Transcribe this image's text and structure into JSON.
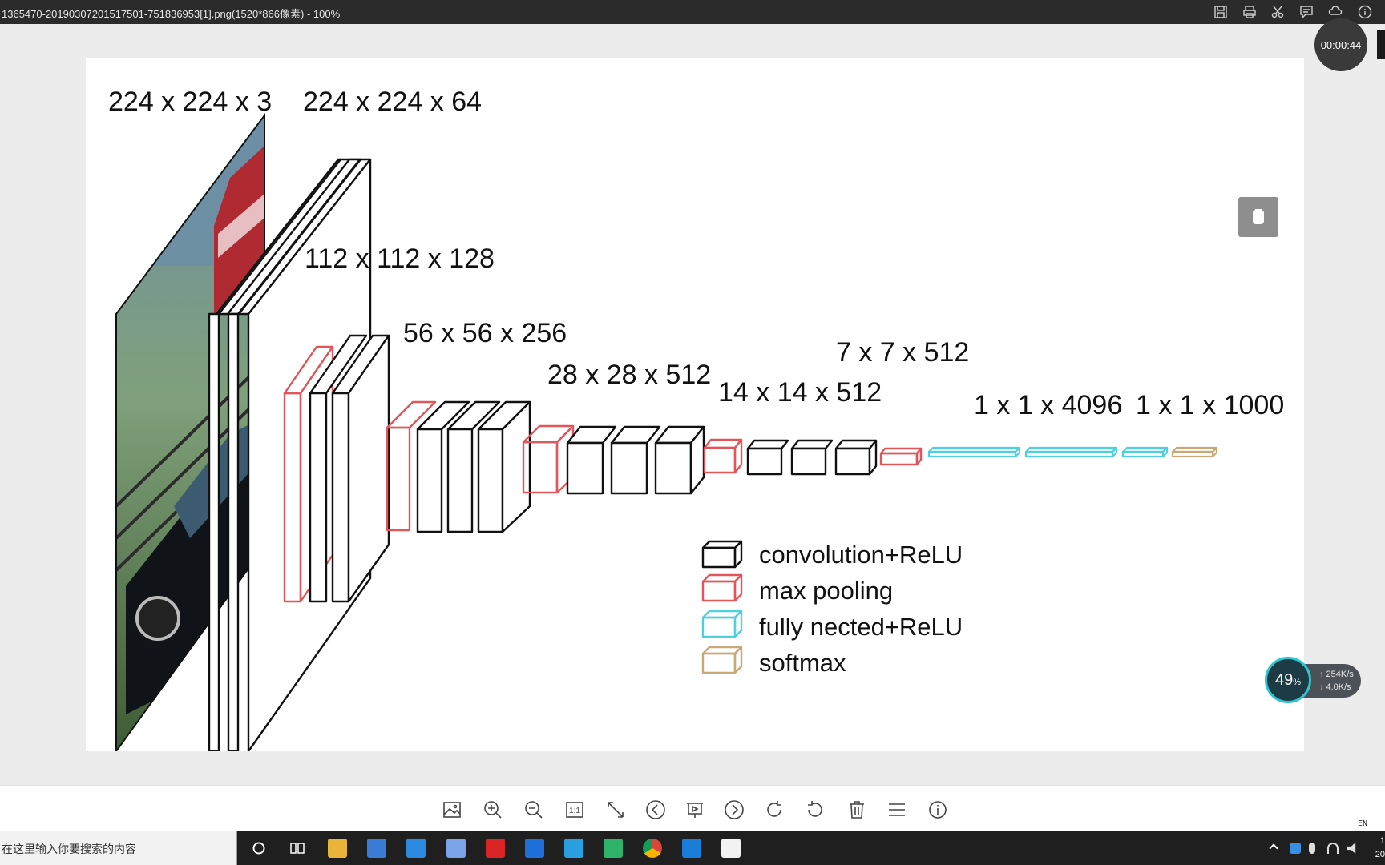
{
  "window": {
    "title": "1365470-20190307201517501-751836953[1].png(1520*866像素) - 100%",
    "icons": [
      "save-icon",
      "print-icon",
      "cut-icon",
      "comment-icon",
      "cloud-icon",
      "info-icon"
    ]
  },
  "timer": {
    "text": "00:00:44"
  },
  "figure": {
    "layer_labels": {
      "input": "224 x 224 x 3",
      "conv1": "224 x 224 x 64",
      "conv2": "112 x 112 x 128",
      "conv3": "56 x 56 x 256",
      "conv4": "28 x 28 x 512",
      "conv5": "14 x 14 x 512",
      "pool5": "7 x 7 x 512",
      "fc": "1 x 1 x 4096",
      "softmax": "1 x 1 x 1000"
    },
    "legend": {
      "conv": "convolution+ReLU",
      "pool": "max pooling",
      "fc": "fully nected+ReLU",
      "softmax": "softmax"
    },
    "colors": {
      "conv": "#111111",
      "pool": "#e0565a",
      "fc": "#4fcfe0",
      "softmax": "#c8a878"
    }
  },
  "speed_widget": {
    "percent": "49",
    "percent_unit": "%",
    "upload": "254K/s",
    "download": "4.0K/s"
  },
  "toolbar": {
    "tools": [
      "image-icon",
      "zoom-in-icon",
      "zoom-out-icon",
      "actual-size-icon",
      "fit-screen-icon",
      "previous-icon",
      "slideshow-icon",
      "next-icon",
      "rotate-right-icon",
      "rotate-left-icon",
      "delete-icon",
      "menu-icon",
      "info-icon"
    ],
    "actual_size_label": "1:1"
  },
  "ime": {
    "text": "EN"
  },
  "taskbar": {
    "search_placeholder": "在这里输入你要搜索的内容",
    "apps": [
      "cortana-icon",
      "task-view-icon",
      "file-explorer-icon",
      "store-icon",
      "mail-icon",
      "app-icon",
      "red-app-icon",
      "edge-icon",
      "ie-icon",
      "pycharm-icon",
      "chrome-icon",
      "video-app-icon",
      "photo-app-icon"
    ],
    "clock": {
      "line1": "1",
      "line2": "20"
    }
  }
}
